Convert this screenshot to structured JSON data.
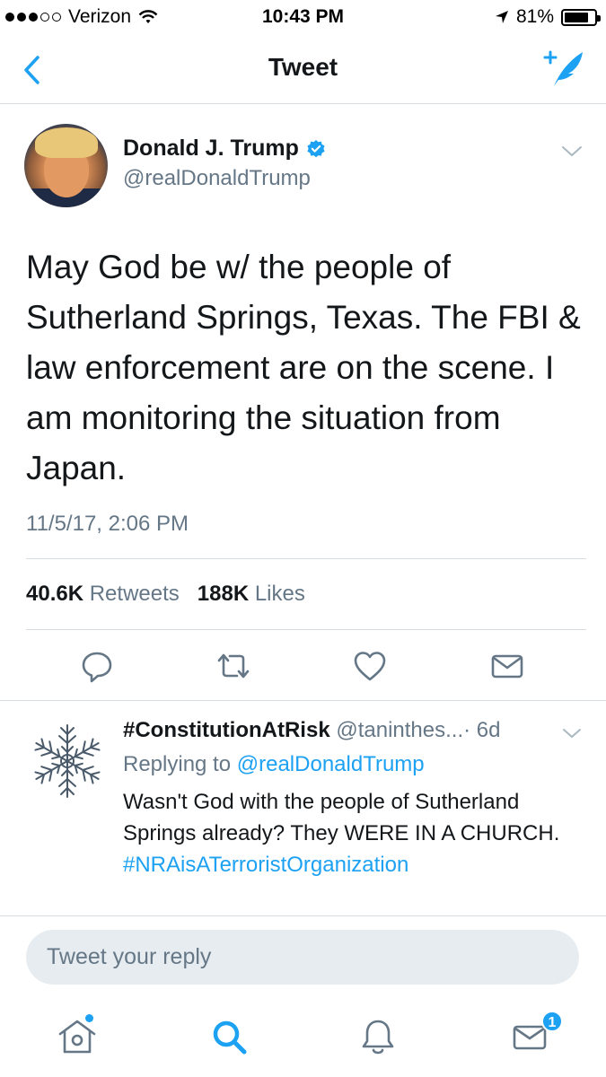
{
  "status_bar": {
    "carrier": "Verizon",
    "time": "10:43 PM",
    "battery": "81%",
    "battery_level": 0.81,
    "signal_bars_filled": 3,
    "signal_bars_total": 5
  },
  "nav": {
    "title": "Tweet",
    "back_icon": "chevron-left-icon",
    "compose_icon": "compose-tweet-icon"
  },
  "tweet": {
    "author_name": "Donald J. Trump",
    "author_handle": "@realDonaldTrump",
    "verified": true,
    "text": "May God be w/ the people of Sutherland Springs, Texas. The FBI & law enforcement are on the scene. I am monitoring the situation from Japan.",
    "timestamp": "11/5/17, 2:06 PM",
    "retweets_count": "40.6K",
    "retweets_label": "Retweets",
    "likes_count": "188K",
    "likes_label": "Likes"
  },
  "actions": [
    "reply-icon",
    "retweet-icon",
    "like-icon",
    "share-dm-icon"
  ],
  "reply": {
    "author_name": "#ConstitutionAtRisk",
    "author_handle": "@taninthes...",
    "age": "· 6d",
    "replying_prefix": "Replying to",
    "replying_to": "@realDonaldTrump",
    "text": "Wasn't God with the people of Sutherland Springs already? They WERE IN A CHURCH.",
    "hashtag": "#NRAisATerroristOrganization"
  },
  "reply_box": {
    "placeholder": "Tweet your reply"
  },
  "tab_bar": {
    "tabs": [
      "home-icon",
      "search-icon",
      "notifications-icon",
      "messages-icon"
    ],
    "messages_badge": "1"
  },
  "colors": {
    "accent": "#1da1f2",
    "text_primary": "#14171a",
    "text_secondary": "#657786",
    "divider": "#d8dde1",
    "reply_box_bg": "#e6ecf0"
  }
}
